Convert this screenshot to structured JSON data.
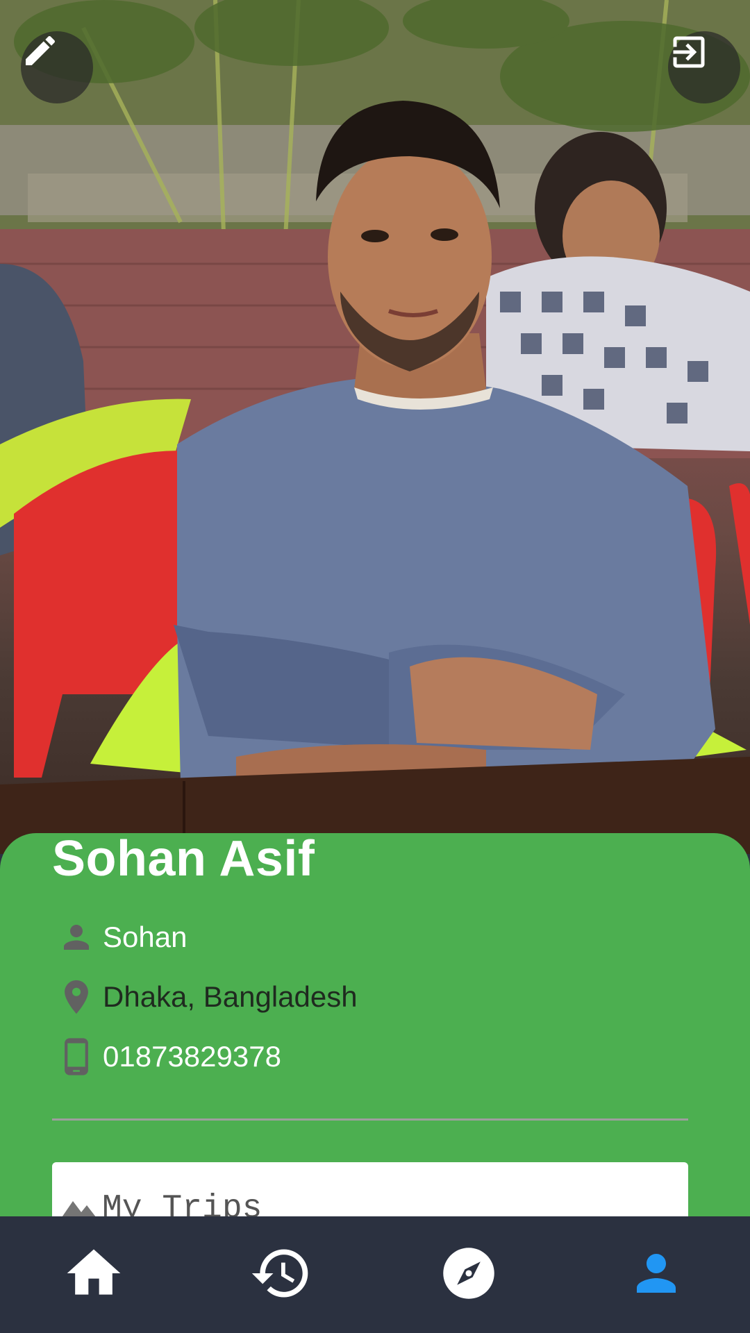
{
  "profile": {
    "full_name": "Sohan Asif",
    "username": "Sohan",
    "location": "Dhaka, Bangladesh",
    "phone": "01873829378"
  },
  "header": {
    "edit_icon": "pencil-icon",
    "logout_icon": "exit-icon"
  },
  "trips": {
    "label": "My Trips",
    "icon": "mountain-icon"
  },
  "bottom_nav": {
    "items": [
      {
        "name": "home",
        "icon": "home-icon",
        "active": false
      },
      {
        "name": "history",
        "icon": "history-icon",
        "active": false
      },
      {
        "name": "explore",
        "icon": "compass-icon",
        "active": false
      },
      {
        "name": "profile",
        "icon": "person-icon",
        "active": true
      }
    ]
  },
  "colors": {
    "card_green": "#4caf50",
    "nav_background": "#2b3140",
    "nav_active": "#2196f3",
    "nav_inactive": "#ffffff"
  }
}
